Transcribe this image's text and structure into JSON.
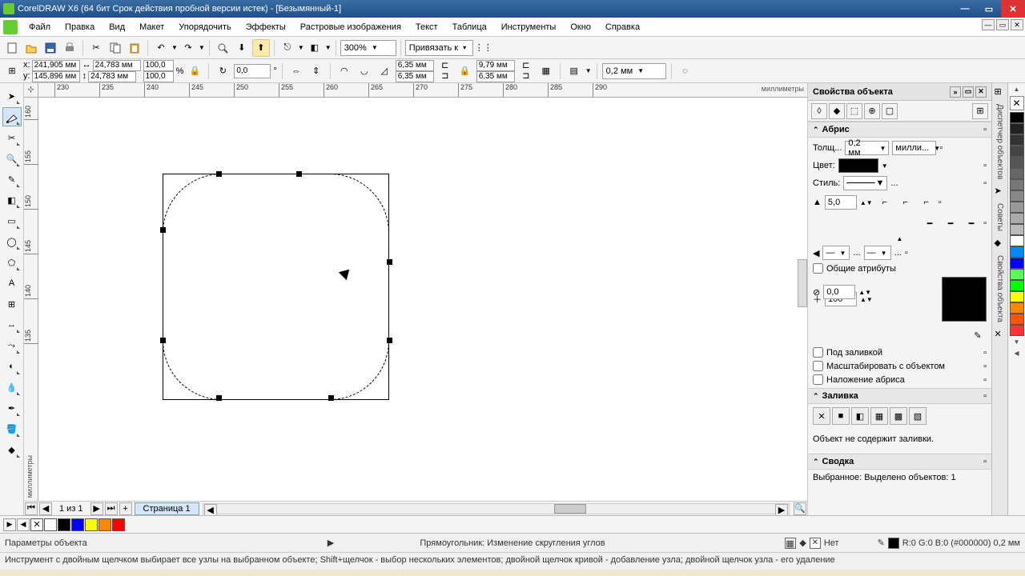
{
  "window": {
    "title": "CorelDRAW X6 (64 бит Срок действия пробной версии истек) - [Безымянный-1]"
  },
  "menu": [
    "Файл",
    "Правка",
    "Вид",
    "Макет",
    "Упорядочить",
    "Эффекты",
    "Растровые изображения",
    "Текст",
    "Таблица",
    "Инструменты",
    "Окно",
    "Справка"
  ],
  "toolbar1": {
    "zoom": "300%",
    "snap": "Привязать к"
  },
  "propbar": {
    "x": "241,905 мм",
    "y": "145,896 мм",
    "w": "24,783 мм",
    "h": "24,783 мм",
    "scale_x": "100,0",
    "scale_y": "100,0",
    "pct": "%",
    "rot": "0,0",
    "deg": "°",
    "corner_a": "6,35 мм",
    "corner_b": "6,35 мм",
    "corner_c": "9,79 мм",
    "corner_d": "6,35 мм",
    "outline": "0,2 мм"
  },
  "ruler": {
    "unit": "миллиметры",
    "h_ticks": [
      "230",
      "235",
      "240",
      "245",
      "250",
      "255",
      "260",
      "265",
      "270",
      "275",
      "280",
      "285",
      "290"
    ],
    "v_ticks": [
      "160",
      "155",
      "150",
      "145",
      "140",
      "135"
    ],
    "v_unit": "миллиметры"
  },
  "pagenav": {
    "counter": "1 из 1",
    "page": "Страница 1"
  },
  "docker": {
    "title": "Свойства объекта",
    "sec_abris": "Абрис",
    "thick_lbl": "Толщ...",
    "thick_val": "0,2 мм",
    "thick_unit": "милли...",
    "color_lbl": "Цвет:",
    "style_lbl": "Стиль:",
    "style_more": "...",
    "miter": "5,0",
    "arrow_more": "...",
    "shared": "Общие атрибуты",
    "opacity": "100",
    "offset": "0,0",
    "behind_fill": "Под заливкой",
    "scale_with": "Масштабировать с объектом",
    "overprint": "Наложение абриса",
    "sec_fill": "Заливка",
    "nofill_msg": "Объект не содержит заливки.",
    "sec_summary": "Сводка",
    "summary_txt": "Выбранное: Выделено объектов: 1"
  },
  "vtabs": [
    "Диспетчер объектов",
    "Советы",
    "Свойства объекта"
  ],
  "palette_colors": [
    "#000",
    "#222",
    "#333",
    "#444",
    "#555",
    "#666",
    "#777",
    "#888",
    "#999",
    "#aaa",
    "#bbb",
    "#fff",
    "#08f",
    "#00f",
    "#5f5",
    "#0f0",
    "#ff0",
    "#f80",
    "#f50",
    "#f33"
  ],
  "bottom_palette": [
    "#fff",
    "#000",
    "#00f",
    "#ff0",
    "#f80",
    "#f00"
  ],
  "status": {
    "left": "Параметры объекта",
    "mid": "Прямоугольник: Изменение скругления углов",
    "rgb": "R:0 G:0 B:0 (#000000)  0,2 мм",
    "none": "Нет"
  },
  "hint": "Инструмент с двойным щелчком выбирает все узлы на выбранном объекте; Shift+щелчок - выбор нескольких элементов; двойной щелчок кривой - добавление узла; двойной щелчок узла - его удаление"
}
